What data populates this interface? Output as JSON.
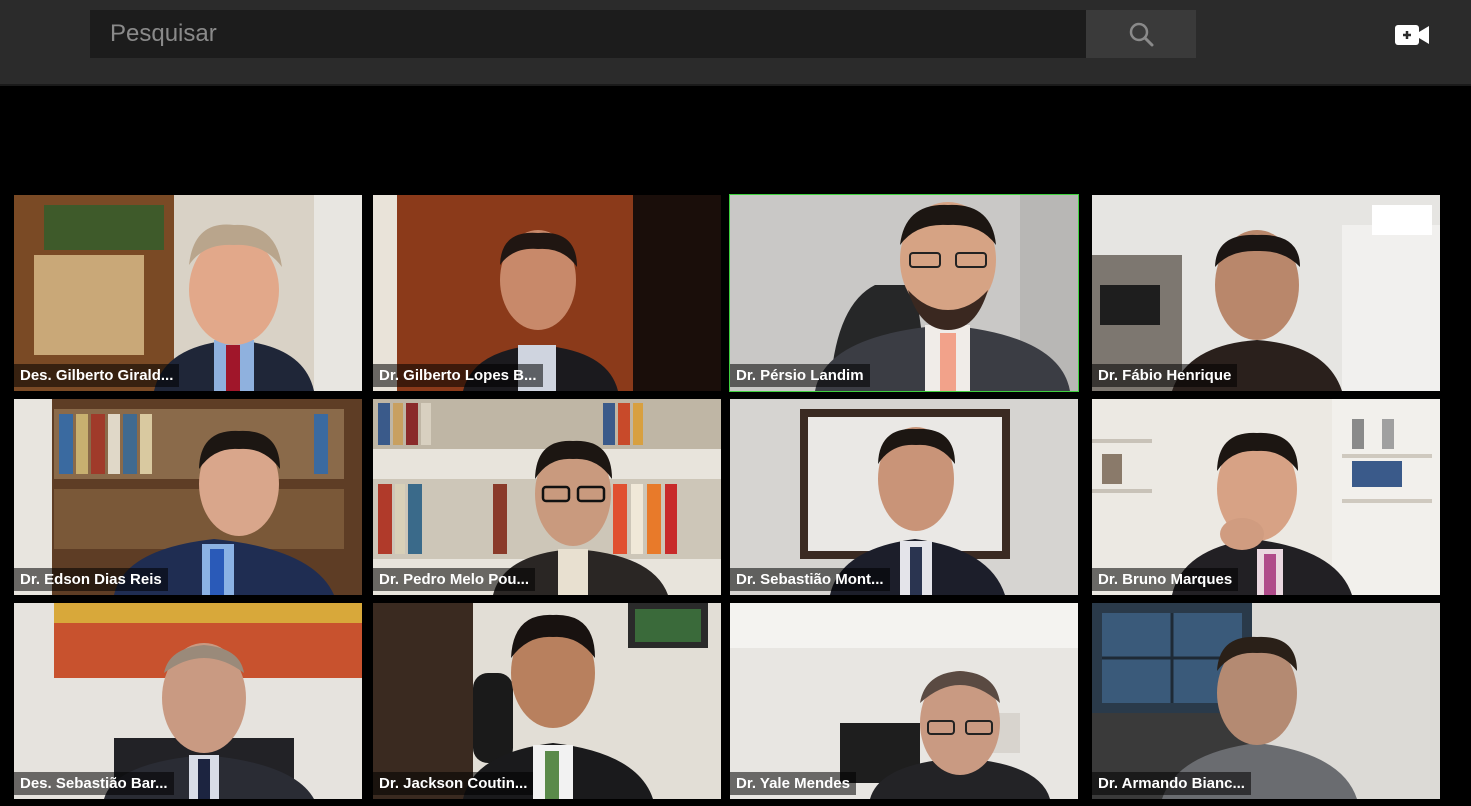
{
  "search": {
    "placeholder": "Pesquisar"
  },
  "icons": {
    "search": "search-icon",
    "camera": "video-camera-icon"
  },
  "colors": {
    "active_speaker_border": "#3fd13f",
    "topbar": "#2b2b2b"
  },
  "participants": [
    {
      "name": "Des. Gilberto Giraldelli",
      "label": "Des. Gilberto Girald...",
      "active": false
    },
    {
      "name": "Dr. Gilberto Lopes Bussiki",
      "label": "Dr. Gilberto Lopes B...",
      "active": false
    },
    {
      "name": "Dr. Pérsio Landim",
      "label": "Dr. Pérsio Landim",
      "active": true
    },
    {
      "name": "Dr. Fábio Henrique",
      "label": "Dr. Fábio Henrique",
      "active": false
    },
    {
      "name": "Dr. Edson Dias Reis",
      "label": "Dr. Edson Dias Reis",
      "active": false
    },
    {
      "name": "Dr. Pedro Melo Pouso",
      "label": "Dr. Pedro Melo Pou...",
      "active": false
    },
    {
      "name": "Dr. Sebastião Monteiro",
      "label": "Dr. Sebastião Mont...",
      "active": false
    },
    {
      "name": "Dr. Bruno Marques",
      "label": "Dr. Bruno Marques",
      "active": false
    },
    {
      "name": "Des. Sebastião Barbosa",
      "label": "Des. Sebastião Bar...",
      "active": false
    },
    {
      "name": "Dr. Jackson Coutinho",
      "label": "Dr. Jackson Coutin...",
      "active": false
    },
    {
      "name": "Dr. Yale Mendes",
      "label": "Dr. Yale Mendes",
      "active": false
    },
    {
      "name": "Dr. Armando Biancardini",
      "label": "Dr. Armando Bianc...",
      "active": false
    }
  ]
}
